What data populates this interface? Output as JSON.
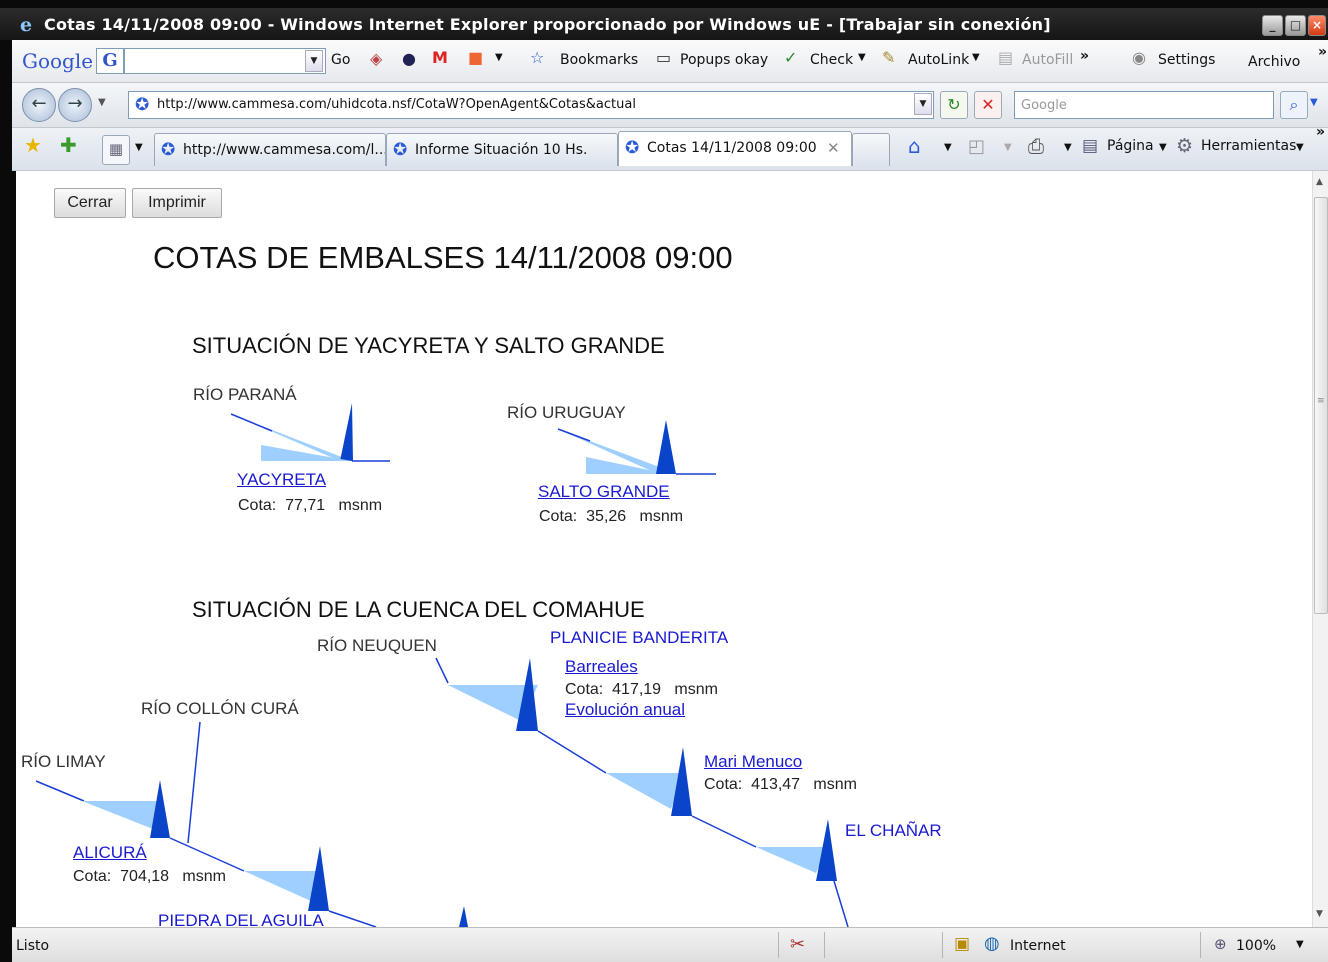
{
  "window": {
    "title": "Cotas 14/11/2008 09:00 - Windows Internet Explorer proporcionado por Windows uE - [Trabajar sin conexión]"
  },
  "google_toolbar": {
    "logo": "Google",
    "go_label": "Go",
    "bookmarks_label": "Bookmarks",
    "popups_label": "Popups okay",
    "check_label": "Check",
    "autolink_label": "AutoLink",
    "autofill_label": "AutoFill",
    "more": "»",
    "settings_label": "Settings",
    "archivo_label": "Archivo"
  },
  "address_bar": {
    "url": "http://www.cammesa.com/uhidcota.nsf/CotaW?OpenAgent&Cotas&actual",
    "search_placeholder": "Google"
  },
  "tabs": [
    {
      "label": "http://www.cammesa.com/l..."
    },
    {
      "label": "Informe Situación 10 Hs."
    },
    {
      "label": "Cotas 14/11/2008 09:00",
      "active": true
    }
  ],
  "command_bar": {
    "pagina_label": "Página",
    "herramientas_label": "Herramientas",
    "more": "»"
  },
  "page": {
    "buttons": {
      "close": "Cerrar",
      "print": "Imprimir"
    },
    "title": "COTAS DE EMBALSES 14/11/2008 09:00",
    "section1": "SITUACIÓN DE YACYRETA Y SALTO GRANDE",
    "rio_parana": "RÍO PARANÁ",
    "yacyreta": {
      "name": "YACYRETA",
      "cota_label": "Cota:",
      "cota_value": "77,71",
      "unit": "msnm"
    },
    "rio_uruguay": "RÍO URUGUAY",
    "salto_grande": {
      "name": "SALTO GRANDE",
      "cota_label": "Cota:",
      "cota_value": "35,26",
      "unit": "msnm"
    },
    "section2": "SITUACIÓN DE LA CUENCA DEL COMAHUE",
    "rio_neuquen": "RÍO NEUQUEN",
    "planicie": "PLANICIE BANDERITA",
    "barreales": {
      "name": "Barreales",
      "cota_label": "Cota:",
      "cota_value": "417,19",
      "unit": "msnm",
      "evolucion": "Evolución anual"
    },
    "rio_collon": "RÍO COLLÓN CURÁ",
    "rio_limay": "RÍO LIMAY",
    "mari_menuco": {
      "name": "Mari Menuco",
      "cota_label": "Cota:",
      "cota_value": "413,47",
      "unit": "msnm"
    },
    "el_chanar": "EL CHAÑAR",
    "alicura": {
      "name": "ALICURÁ",
      "cota_label": "Cota:",
      "cota_value": "704,18",
      "unit": "msnm"
    },
    "piedra_del_aguila": "PIEDRA DEL AGUILA"
  },
  "status_bar": {
    "status": "Listo",
    "zone": "Internet",
    "zoom": "100%"
  }
}
